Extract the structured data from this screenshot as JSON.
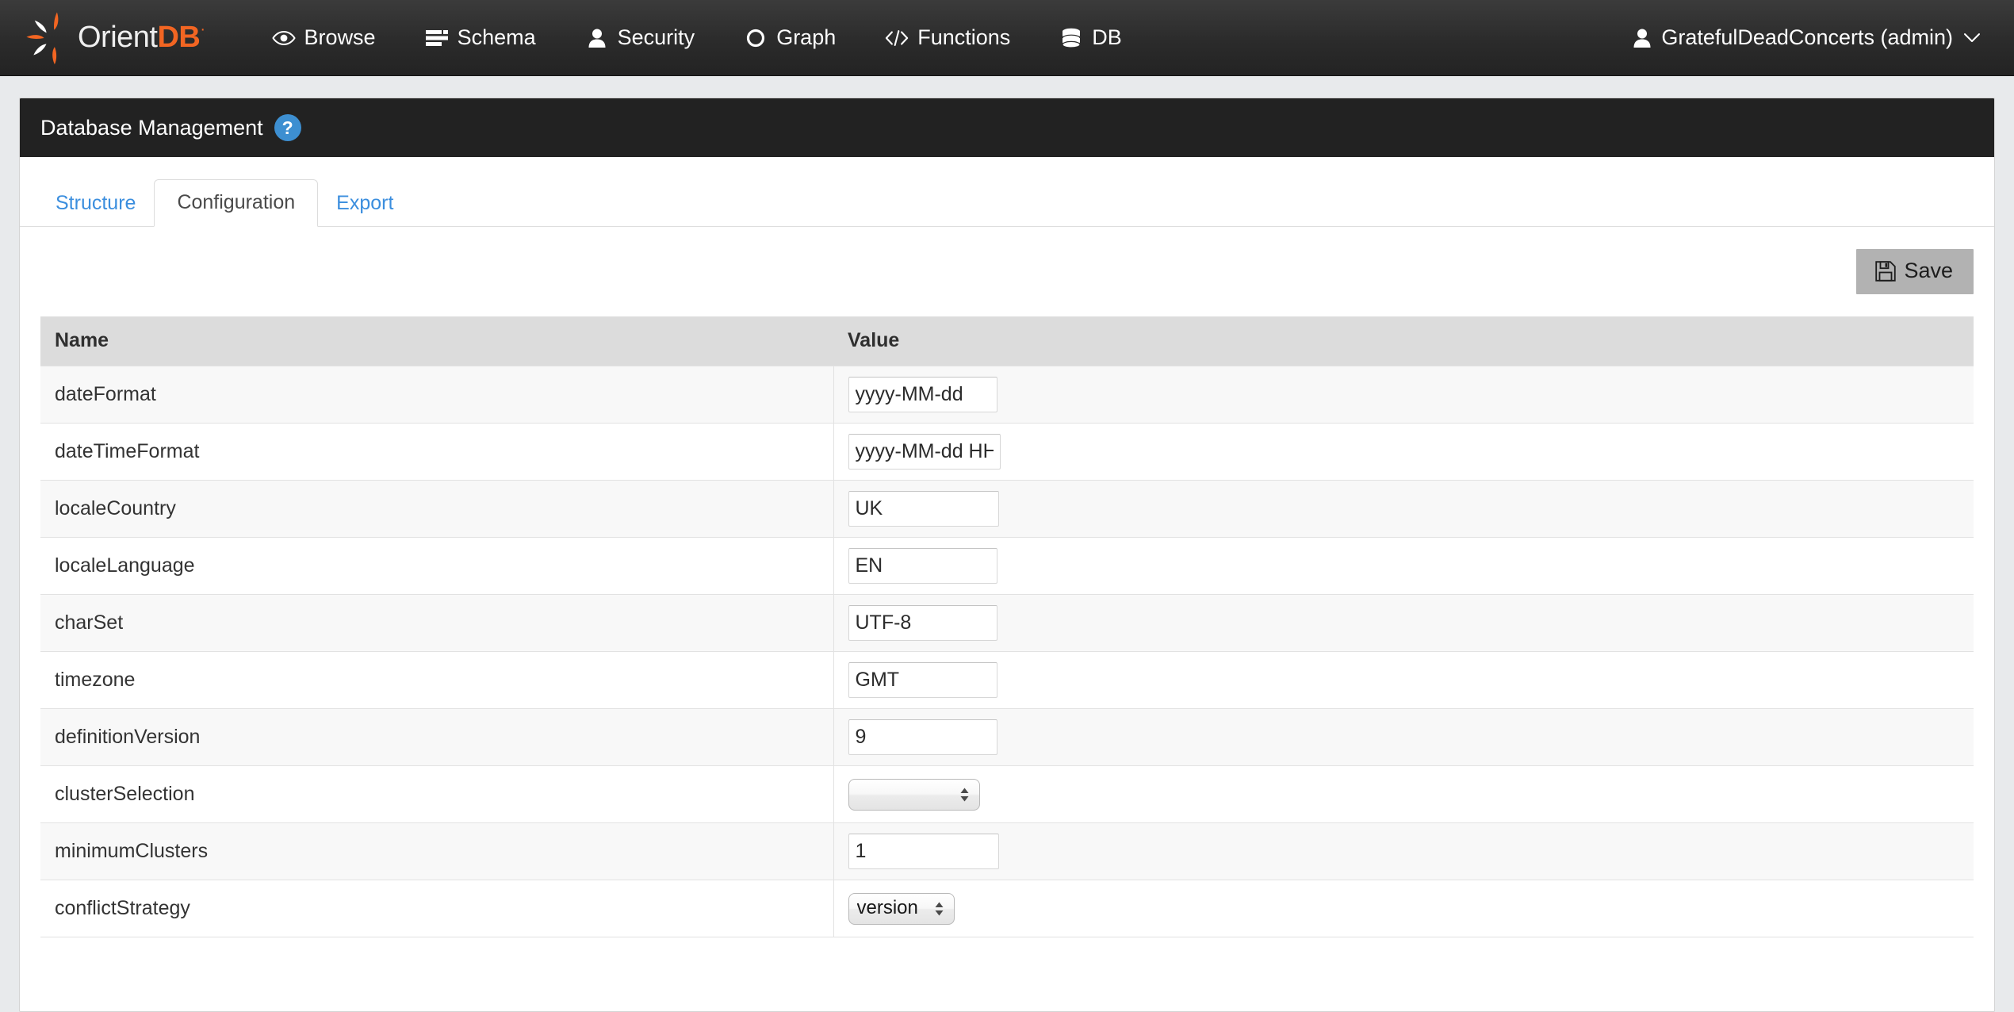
{
  "navbar": {
    "brand": {
      "word1": "Orient",
      "word2": "DB",
      "trademark": "·",
      "icon": "orientdb-logo-icon"
    },
    "items": [
      {
        "label": "Browse",
        "icon": "eye-icon"
      },
      {
        "label": "Schema",
        "icon": "schema-list-icon"
      },
      {
        "label": "Security",
        "icon": "user-icon"
      },
      {
        "label": "Graph",
        "icon": "circle-icon"
      },
      {
        "label": "Functions",
        "icon": "code-icon"
      },
      {
        "label": "DB",
        "icon": "database-icon"
      }
    ],
    "user": {
      "label": "GratefulDeadConcerts (admin)",
      "icon": "user-icon",
      "caret": "⌄"
    }
  },
  "card": {
    "title": "Database Management",
    "help_icon_label": "?",
    "tabs": [
      {
        "label": "Structure",
        "active": false
      },
      {
        "label": "Configuration",
        "active": true
      },
      {
        "label": "Export",
        "active": false
      }
    ]
  },
  "toolbar": {
    "save_label": "Save",
    "save_icon": "floppy-save-icon"
  },
  "table": {
    "headers": {
      "name": "Name",
      "value": "Value"
    },
    "rows": [
      {
        "name": "dateFormat",
        "type": "text",
        "value": "yyyy-MM-dd"
      },
      {
        "name": "dateTimeFormat",
        "type": "text",
        "value": "yyyy-MM-dd HH:mm:ss"
      },
      {
        "name": "localeCountry",
        "type": "text",
        "value": "UK"
      },
      {
        "name": "localeLanguage",
        "type": "text",
        "value": "EN"
      },
      {
        "name": "charSet",
        "type": "text",
        "value": "UTF-8"
      },
      {
        "name": "timezone",
        "type": "text",
        "value": "GMT"
      },
      {
        "name": "definitionVersion",
        "type": "text",
        "value": "9"
      },
      {
        "name": "clusterSelection",
        "type": "select",
        "value": ""
      },
      {
        "name": "minimumClusters",
        "type": "text",
        "value": "1"
      },
      {
        "name": "conflictStrategy",
        "type": "select",
        "value": "version"
      }
    ]
  },
  "colors": {
    "navbar_bg": "#2b2b2b",
    "card_header_bg": "#222222",
    "accent_blue": "#3b8ede",
    "help_blue": "#3d8fd1",
    "brand_orange": "#f26522",
    "save_button_bg": "#b2b2b2",
    "table_header_bg": "#dcdcdc",
    "page_bg": "#e8eaec"
  }
}
